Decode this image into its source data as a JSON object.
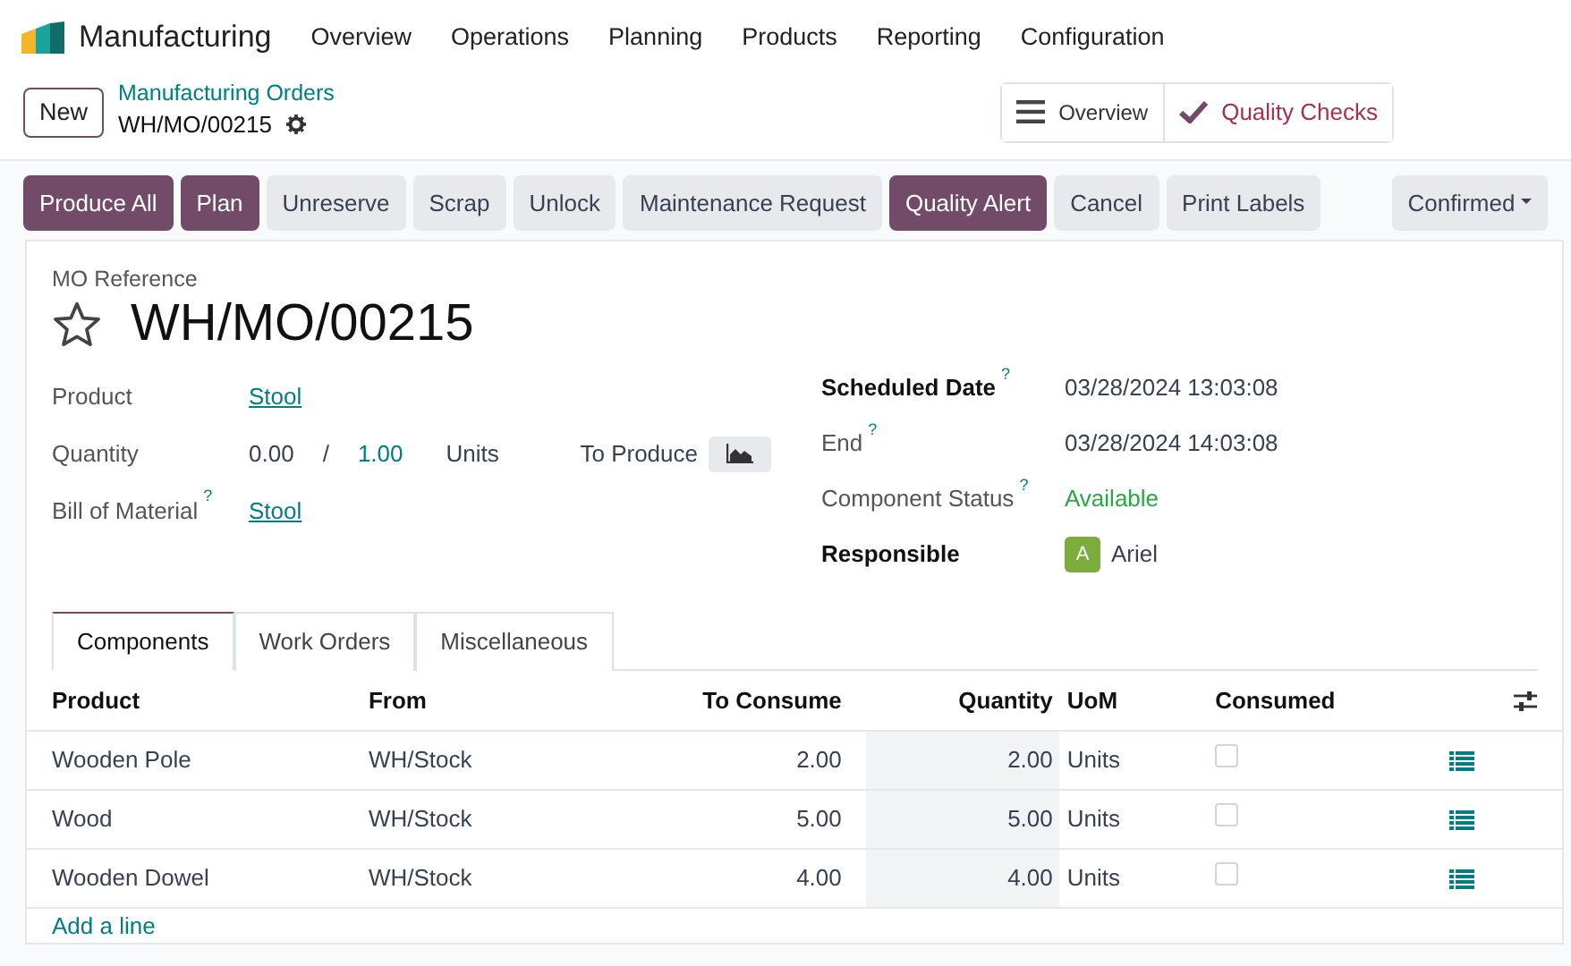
{
  "app": {
    "name": "Manufacturing"
  },
  "menu": [
    "Overview",
    "Operations",
    "Planning",
    "Products",
    "Reporting",
    "Configuration"
  ],
  "breadcrumb": {
    "new_button": "New",
    "parent": "Manufacturing Orders",
    "current": "WH/MO/00215"
  },
  "smart_buttons": [
    {
      "kind": "menu",
      "label": "Overview"
    },
    {
      "kind": "check",
      "label": "Quality Checks"
    }
  ],
  "actions": [
    {
      "label": "Produce All",
      "primary": true
    },
    {
      "label": "Plan",
      "primary": true
    },
    {
      "label": "Unreserve",
      "primary": false
    },
    {
      "label": "Scrap",
      "primary": false
    },
    {
      "label": "Unlock",
      "primary": false
    },
    {
      "label": "Maintenance Request",
      "primary": false
    },
    {
      "label": "Quality Alert",
      "primary": true
    },
    {
      "label": "Cancel",
      "primary": false
    },
    {
      "label": "Print Labels",
      "primary": false
    }
  ],
  "status": "Confirmed",
  "form": {
    "reference_label": "MO Reference",
    "reference": "WH/MO/00215",
    "starred": false,
    "left": [
      {
        "kind": "link",
        "label": "Product",
        "value": "Stool"
      },
      {
        "kind": "quantity",
        "label": "Quantity",
        "produced": "0.00",
        "separator": "/",
        "target": "1.00",
        "unit": "Units",
        "extra_label": "To Produce"
      },
      {
        "kind": "link",
        "label": "Bill of Material",
        "help": "?",
        "value": "Stool"
      }
    ],
    "right": [
      {
        "kind": "text",
        "label": "Scheduled Date",
        "help": "?",
        "strong": true,
        "value": "03/28/2024 13:03:08"
      },
      {
        "kind": "text",
        "label": "End",
        "help": "?",
        "strong": false,
        "value": "03/28/2024 14:03:08"
      },
      {
        "kind": "status",
        "label": "Component Status",
        "help": "?",
        "strong": false,
        "value": "Available"
      },
      {
        "kind": "user",
        "label": "Responsible",
        "strong": true,
        "initial": "A",
        "value": "Ariel",
        "color": "#7cac3c"
      }
    ]
  },
  "tabs": [
    {
      "label": "Components",
      "selected": true
    },
    {
      "label": "Work Orders",
      "selected": false
    },
    {
      "label": "Miscellaneous",
      "selected": false
    }
  ],
  "table": {
    "columns": [
      "Product",
      "From",
      "To Consume",
      "Quantity",
      "UoM",
      "Consumed"
    ],
    "rows": [
      {
        "product": "Wooden Pole",
        "from": "WH/Stock",
        "to_consume": "2.00",
        "quantity": "2.00",
        "uom": "Units",
        "consumed": false
      },
      {
        "product": "Wood",
        "from": "WH/Stock",
        "to_consume": "5.00",
        "quantity": "5.00",
        "uom": "Units",
        "consumed": false
      },
      {
        "product": "Wooden Dowel",
        "from": "WH/Stock",
        "to_consume": "4.00",
        "quantity": "4.00",
        "uom": "Units",
        "consumed": false
      }
    ],
    "add_line": "Add a line"
  }
}
